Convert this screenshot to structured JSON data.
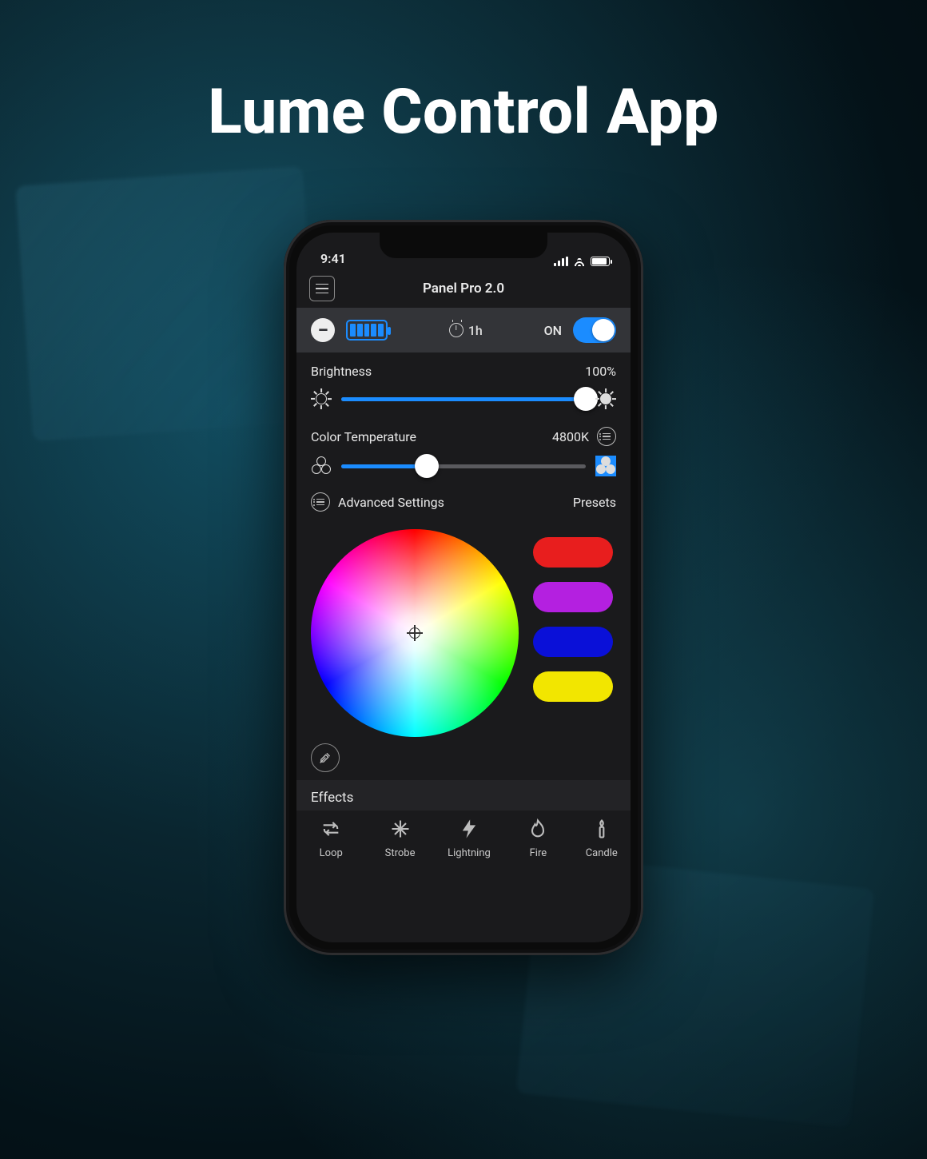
{
  "hero": {
    "title": "Lume Control App"
  },
  "statusbar": {
    "time": "9:41"
  },
  "navbar": {
    "title": "Panel Pro 2.0"
  },
  "strip": {
    "timer_label": "1h",
    "power_label": "ON"
  },
  "brightness": {
    "label": "Brightness",
    "value_label": "100%",
    "percent": 100
  },
  "color_temp": {
    "label": "Color Temperature",
    "value_label": "4800K",
    "percent": 35
  },
  "advanced": {
    "label": "Advanced Settings",
    "presets_label": "Presets"
  },
  "swatches": {
    "colors": [
      "#e81e1e",
      "#b420e0",
      "#0a10d8",
      "#f2e600"
    ]
  },
  "effects": {
    "section_label": "Effects",
    "items": [
      {
        "label": "Loop"
      },
      {
        "label": "Strobe"
      },
      {
        "label": "Lightning"
      },
      {
        "label": "Fire"
      },
      {
        "label": "Candle"
      }
    ]
  }
}
